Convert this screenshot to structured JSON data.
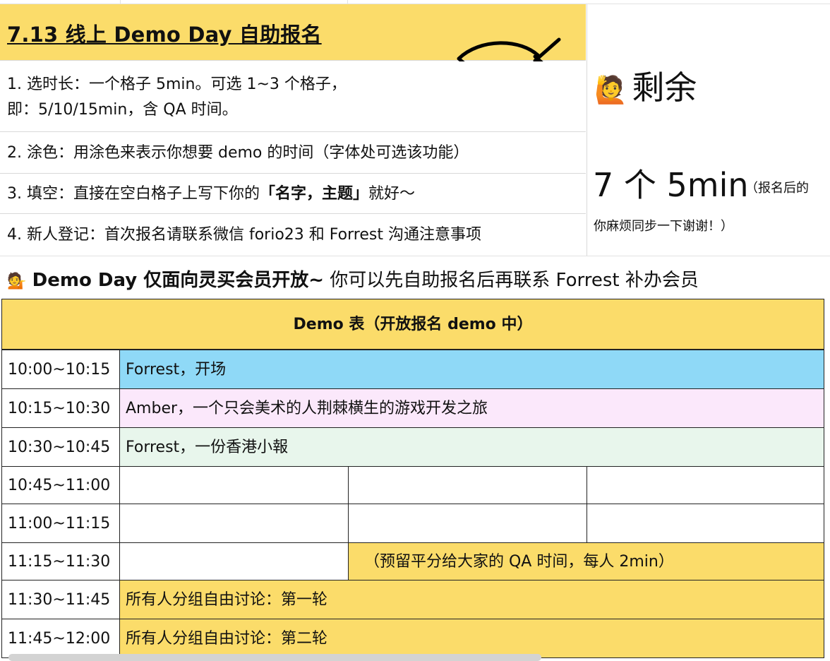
{
  "header": {
    "title": "7.13 线上 Demo Day 自助报名",
    "fish_icon": "fish-outline-icon",
    "instructions": [
      {
        "line1": "1. 选时长：一个格子 5min。可选 1~3 个格子，",
        "line2": "即：5/10/15min，含 QA 时间。"
      },
      {
        "line1": "2. 涂色：用涂色来表示你想要 demo 的时间（字体处可选该功能）"
      },
      {
        "pre": "3. 填空：直接在空白格子上写下你的",
        "bold": "「名字，主题」",
        "post": "就好～"
      },
      {
        "line1": "4. 新人登记：首次报名请联系微信 forio23 和 Forrest 沟通注意事项"
      }
    ]
  },
  "remaining": {
    "emoji": "🙋",
    "label": "剩余",
    "count_text": "7 个 5min",
    "note_part1": "（报名后的",
    "note_part2": "你麻烦同步一下谢谢！）"
  },
  "notice": {
    "emoji": "💁",
    "bold_text": "Demo Day 仅面向灵买会员开放~",
    "normal_text": " 你可以先自助报名后再联系 Forrest 补办会员"
  },
  "table": {
    "header": "Demo 表（开放报名 demo 中）",
    "rows": [
      {
        "time": "10:00~10:15",
        "content": "Forrest，开场",
        "color": "#8fd9f7"
      },
      {
        "time": "10:15~10:30",
        "content": "Amber，一个只会美术的人荆棘横生的游戏开发之旅",
        "color": "#fbe8fb"
      },
      {
        "time": "10:30~10:45",
        "content": "Forrest，一份香港小報",
        "color": "#e8f6ec"
      },
      {
        "time": "10:45~11:00",
        "slots": [
          "",
          "",
          ""
        ]
      },
      {
        "time": "11:00~11:15",
        "slots": [
          "",
          "",
          ""
        ]
      },
      {
        "time": "11:15~11:30",
        "slot1": "",
        "qa": "（预留平分给大家的 QA 时间，每人 2min）",
        "color": "#fbdc6a"
      },
      {
        "time": "11:30~11:45",
        "content": "所有人分组自由讨论：第一轮",
        "color": "#fbdc6a"
      },
      {
        "time": "11:45~12:00",
        "content": "所有人分组自由讨论：第二轮",
        "color": "#fbdc6a"
      }
    ]
  },
  "colors": {
    "title_bg": "#fbdc6a",
    "accent_yellow": "#fbdc6a",
    "blue": "#8fd9f7",
    "pink": "#fbe8fb",
    "green": "#e8f6ec"
  }
}
